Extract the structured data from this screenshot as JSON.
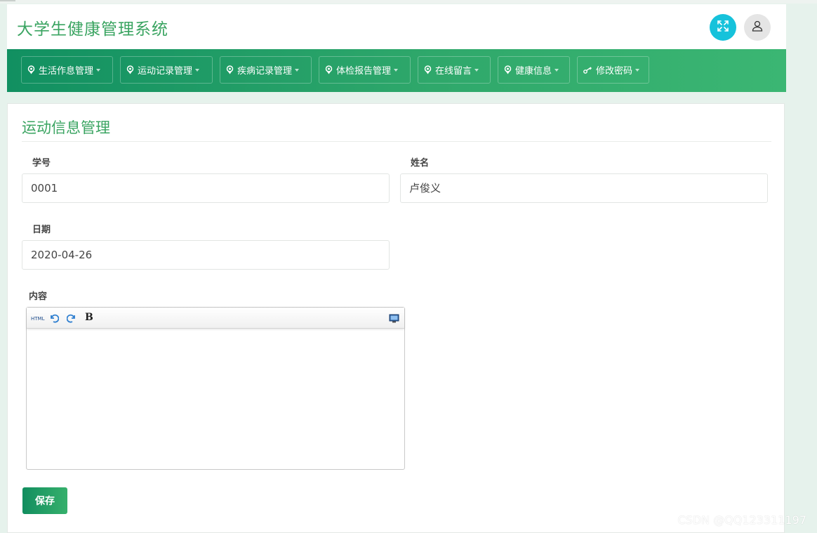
{
  "app": {
    "title": "大学生健康管理系统"
  },
  "header": {
    "fullscreen_icon": "expand-icon",
    "user_icon": "user-icon"
  },
  "nav": {
    "items": [
      {
        "label": "生活作息管理",
        "icon": "leaf-icon"
      },
      {
        "label": "运动记录管理",
        "icon": "leaf-icon"
      },
      {
        "label": "疾病记录管理",
        "icon": "leaf-icon"
      },
      {
        "label": "体检报告管理",
        "icon": "leaf-icon"
      },
      {
        "label": "在线留言",
        "icon": "leaf-icon"
      },
      {
        "label": "健康信息",
        "icon": "leaf-icon"
      },
      {
        "label": "修改密码",
        "icon": "key-icon"
      }
    ]
  },
  "panel": {
    "title": "运动信息管理"
  },
  "form": {
    "student_id": {
      "label": "学号",
      "value": "0001"
    },
    "name": {
      "label": "姓名",
      "value": "卢俊义"
    },
    "date": {
      "label": "日期",
      "value": "2020-04-26"
    },
    "content": {
      "label": "内容",
      "value": ""
    }
  },
  "editor": {
    "html_label": "HTML",
    "bold_label": "B"
  },
  "actions": {
    "save_label": "保存"
  },
  "watermark": "CSDN @QQ123311197",
  "colors": {
    "accent": "#3aa461",
    "nav_start": "#119061",
    "nav_end": "#3bb673",
    "fullscreen_btn": "#16c2db"
  }
}
